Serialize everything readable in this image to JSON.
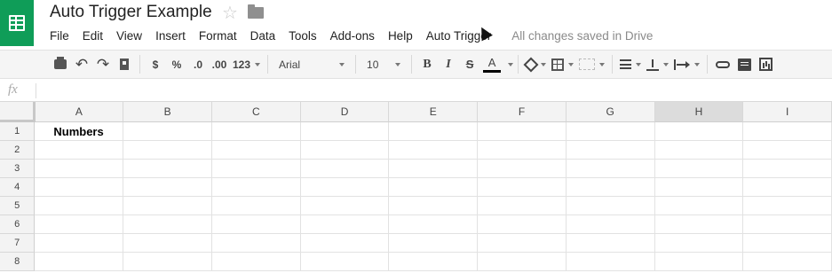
{
  "app": {
    "title": "Auto Trigger Example",
    "icons": [
      "sheets-logo-icon",
      "star-icon",
      "folder-icon"
    ]
  },
  "menu": {
    "items": [
      "File",
      "Edit",
      "View",
      "Insert",
      "Format",
      "Data",
      "Tools",
      "Add-ons",
      "Help",
      "Auto Trigger"
    ],
    "status": "All changes saved in Drive"
  },
  "toolbar": {
    "currency": "$",
    "percent": "%",
    "decrease_decimal": ".0",
    "increase_decimal": ".00",
    "more_formats": "123",
    "font": "Arial",
    "font_size": "10",
    "bold": "B",
    "italic": "I",
    "strikethrough": "S",
    "text_color": "A",
    "icons": [
      "print-icon",
      "undo-icon",
      "redo-icon",
      "paint-format-icon",
      "fill-color-icon",
      "borders-icon",
      "merge-cells-icon",
      "horizontal-align-icon",
      "vertical-align-icon",
      "text-wrap-icon",
      "link-icon",
      "comment-icon",
      "chart-icon"
    ]
  },
  "formula_bar": {
    "label": "fx",
    "value": ""
  },
  "grid": {
    "columns": [
      "A",
      "B",
      "C",
      "D",
      "E",
      "F",
      "G",
      "H",
      "I"
    ],
    "selected_column": "H",
    "rows": [
      {
        "num": "1",
        "cells": [
          "Numbers",
          "",
          "",
          "",
          "",
          "",
          "",
          "",
          ""
        ]
      },
      {
        "num": "2",
        "cells": [
          "",
          "",
          "",
          "",
          "",
          "",
          "",
          "",
          ""
        ]
      },
      {
        "num": "3",
        "cells": [
          "",
          "",
          "",
          "",
          "",
          "",
          "",
          "",
          ""
        ]
      },
      {
        "num": "4",
        "cells": [
          "",
          "",
          "",
          "",
          "",
          "",
          "",
          "",
          ""
        ]
      },
      {
        "num": "5",
        "cells": [
          "",
          "",
          "",
          "",
          "",
          "",
          "",
          "",
          ""
        ]
      },
      {
        "num": "6",
        "cells": [
          "",
          "",
          "",
          "",
          "",
          "",
          "",
          "",
          ""
        ]
      },
      {
        "num": "7",
        "cells": [
          "",
          "",
          "",
          "",
          "",
          "",
          "",
          "",
          ""
        ]
      },
      {
        "num": "8",
        "cells": [
          "",
          "",
          "",
          "",
          "",
          "",
          "",
          "",
          ""
        ]
      }
    ]
  },
  "colors": {
    "brand": "#0f9d58",
    "selected_header": "#dcdcdc",
    "status_text": "#8a8a8a"
  }
}
